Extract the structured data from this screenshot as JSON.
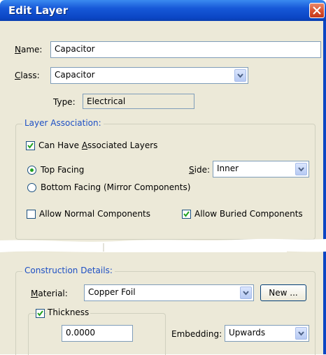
{
  "window": {
    "title": "Edit Layer"
  },
  "form": {
    "name_label_prefix": "N",
    "name_label_rest": "ame:",
    "name_value": "Capacitor",
    "class_label_prefix": "C",
    "class_label_rest": "lass:",
    "class_value": "Capacitor",
    "type_label": "Type:",
    "type_value": "Electrical"
  },
  "layer_association": {
    "title": "Layer Association:",
    "can_have_prefix": "Can Have ",
    "can_have_accel": "A",
    "can_have_rest": "ssociated Layers",
    "can_have_checked": true,
    "top_facing_label": "Top Facing",
    "top_facing_selected": true,
    "bottom_facing_label": "Bottom Facing (Mirror Components)",
    "bottom_facing_selected": false,
    "side_label_prefix": "S",
    "side_label_rest": "ide:",
    "side_value": "Inner",
    "allow_normal_label": "Allow Normal Components",
    "allow_normal_checked": false,
    "allow_buried_label": "Allow Buried Components",
    "allow_buried_checked": true
  },
  "construction": {
    "title": "Construction Details:",
    "material_label_prefix": "M",
    "material_label_rest": "aterial:",
    "material_value": "Copper Foil",
    "new_button": "New ...",
    "thickness_label": "Thickness",
    "thickness_checked": true,
    "thickness_value": "0.0000",
    "embedding_label": "Embedding:",
    "embedding_value": "Upwards"
  },
  "colors": {
    "title_bar": "#0b46c4",
    "dialog_bg": "#ece9d8",
    "group_title": "#1d4fc4",
    "close_button": "#d9502e",
    "check_mark": "#21a121"
  },
  "icons": {
    "close": "close-x-icon",
    "dropdown": "chevron-down-icon",
    "check": "checkmark-icon"
  }
}
